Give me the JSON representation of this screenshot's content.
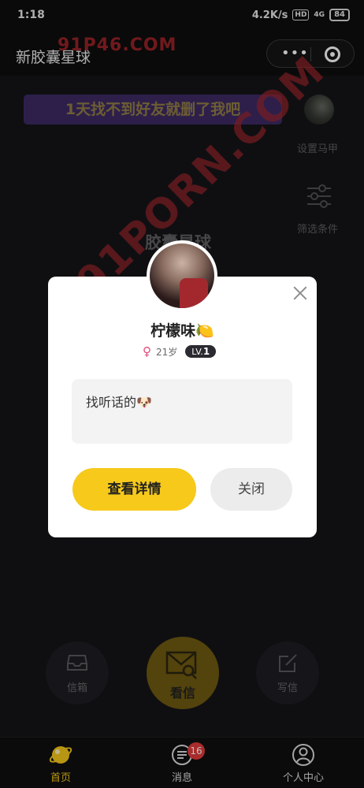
{
  "status_bar": {
    "time": "1:18",
    "speed": "4.2K/s",
    "hd": "HD",
    "signal": "4G",
    "battery": "84"
  },
  "header": {
    "title": "新胶囊星球",
    "watermark": "91P46.COM",
    "more_icon": "more-dots-icon",
    "target_icon": "target-icon"
  },
  "main": {
    "banner": "1天找不到好友就删了我吧",
    "side": {
      "set_alias": "设置马甲",
      "filter": "筛选条件"
    },
    "planet_title": "胶囊星球",
    "big_watermark": "91PORN.COM",
    "inbox_label": "信箱",
    "read_letter_label": "看信",
    "write_letter_label": "写信"
  },
  "modal": {
    "nickname": "柠檬味🍋",
    "gender_icon": "♀",
    "age": "21岁",
    "level_prefix": "LV.",
    "level": "1",
    "message": "找听话的🐶",
    "detail_button": "查看详情",
    "close_button": "关闭"
  },
  "tabbar": {
    "home": "首页",
    "messages": "消息",
    "messages_badge": "16",
    "profile": "个人中心",
    "active_color": "#f6c91b"
  }
}
